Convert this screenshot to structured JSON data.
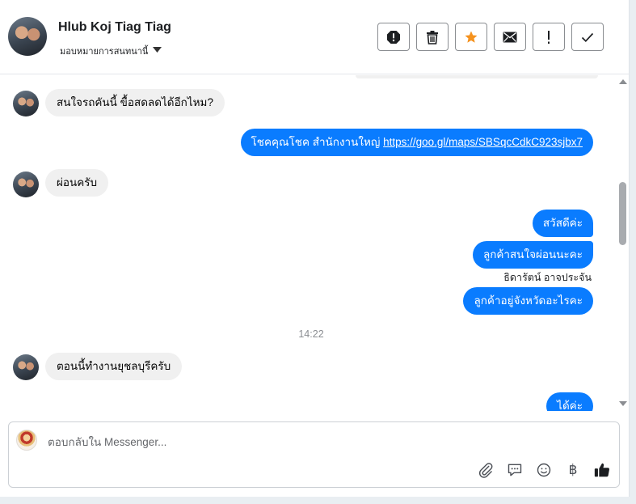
{
  "header": {
    "contact_name": "Hlub Koj Tiag Tiag",
    "assign_label": "มอบหมายการสนทนานี้",
    "actions": [
      {
        "name": "spam-icon"
      },
      {
        "name": "trash-icon"
      },
      {
        "name": "star-icon"
      },
      {
        "name": "mail-icon"
      },
      {
        "name": "follow-up-icon"
      },
      {
        "name": "done-check-icon"
      }
    ],
    "accent_color": "#f5921e"
  },
  "messages": [
    {
      "direction": "in",
      "text": "สนใจรถคันนี้ ขื้อสดลดได้อีกไหม?"
    },
    {
      "direction": "out",
      "text_prefix": "โชคคุณโชค สำนักงานใหญ่ ",
      "link": "https://goo.gl/maps/SBSqcCdkC923sjbx7"
    },
    {
      "direction": "in",
      "text": "ผ่อนครับ"
    },
    {
      "direction": "out",
      "text": "สวัสดีค่ะ"
    },
    {
      "direction": "out",
      "text": "ลูกค้าสนใจผ่อนนะคะ"
    },
    {
      "direction": "label",
      "text": "ธิดารัตน์ อาจประจัน"
    },
    {
      "direction": "out",
      "text": "ลูกค้าอยู่จังหวัดอะไรคะ"
    },
    {
      "direction": "time",
      "text": "14:22"
    },
    {
      "direction": "in",
      "text": "ตอนนี้ทำงานยุชลบุรีครับ"
    },
    {
      "direction": "out",
      "text": "ได้ค่ะ"
    }
  ],
  "composer": {
    "placeholder": "ตอบกลับใน Messenger...",
    "tools": [
      "attachment-icon",
      "saved-replies-icon",
      "emoji-icon",
      "payment-icon",
      "like-icon"
    ],
    "payment_glyph": "฿"
  },
  "colors": {
    "outgoing_bubble": "#0a7cff",
    "incoming_bubble": "#f0f0f0"
  }
}
